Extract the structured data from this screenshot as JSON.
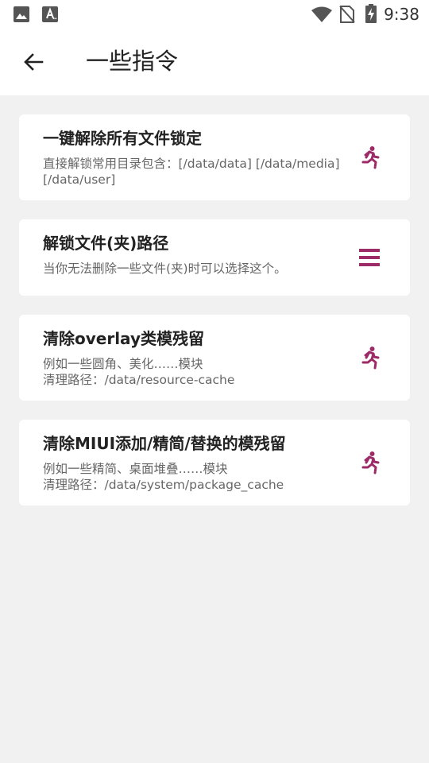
{
  "status_bar": {
    "time": "9:38",
    "icons": [
      "image-icon",
      "text-icon",
      "wifi-icon",
      "no-sim-icon",
      "battery-charging-icon"
    ]
  },
  "header": {
    "title": "一些指令",
    "back_icon": "arrow-left-icon"
  },
  "accent_color": "#9c2b67",
  "commands": [
    {
      "title": "一键解除所有文件锁定",
      "description": "直接解锁常用目录包含：[/data/data] [/data/media]\n[/data/user]",
      "icon": "run-icon"
    },
    {
      "title": "解锁文件(夹)路径",
      "description": "当你无法删除一些文件(夹)时可以选择这个。",
      "icon": "menu-icon"
    },
    {
      "title": "清除overlay类模残留",
      "description": "例如一些圆角、美化……模块\n清理路径：/data/resource-cache",
      "icon": "run-icon"
    },
    {
      "title": "清除MIUI添加/精简/替换的模残留",
      "description": "例如一些精简、桌面堆叠……模块\n清理路径：/data/system/package_cache",
      "icon": "run-icon"
    }
  ]
}
